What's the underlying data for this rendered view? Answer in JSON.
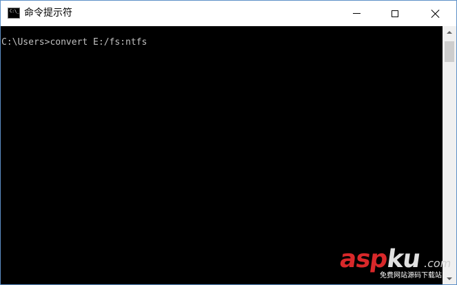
{
  "window": {
    "title": "命令提示符",
    "icon": "cmd-console-icon",
    "icon_label": "C:\\_"
  },
  "controls": {
    "minimize_icon": "minimize-icon",
    "maximize_icon": "maximize-icon",
    "close_icon": "close-icon"
  },
  "console": {
    "lines": [
      "C:\\Users>convert E:/fs:ntfs"
    ],
    "text_color": "#c0c0c0",
    "background": "#000000"
  },
  "watermark": {
    "brand_red": "asp",
    "brand_white": "ku",
    "suffix": ".com",
    "tagline": "免费网站源码下载站!"
  }
}
